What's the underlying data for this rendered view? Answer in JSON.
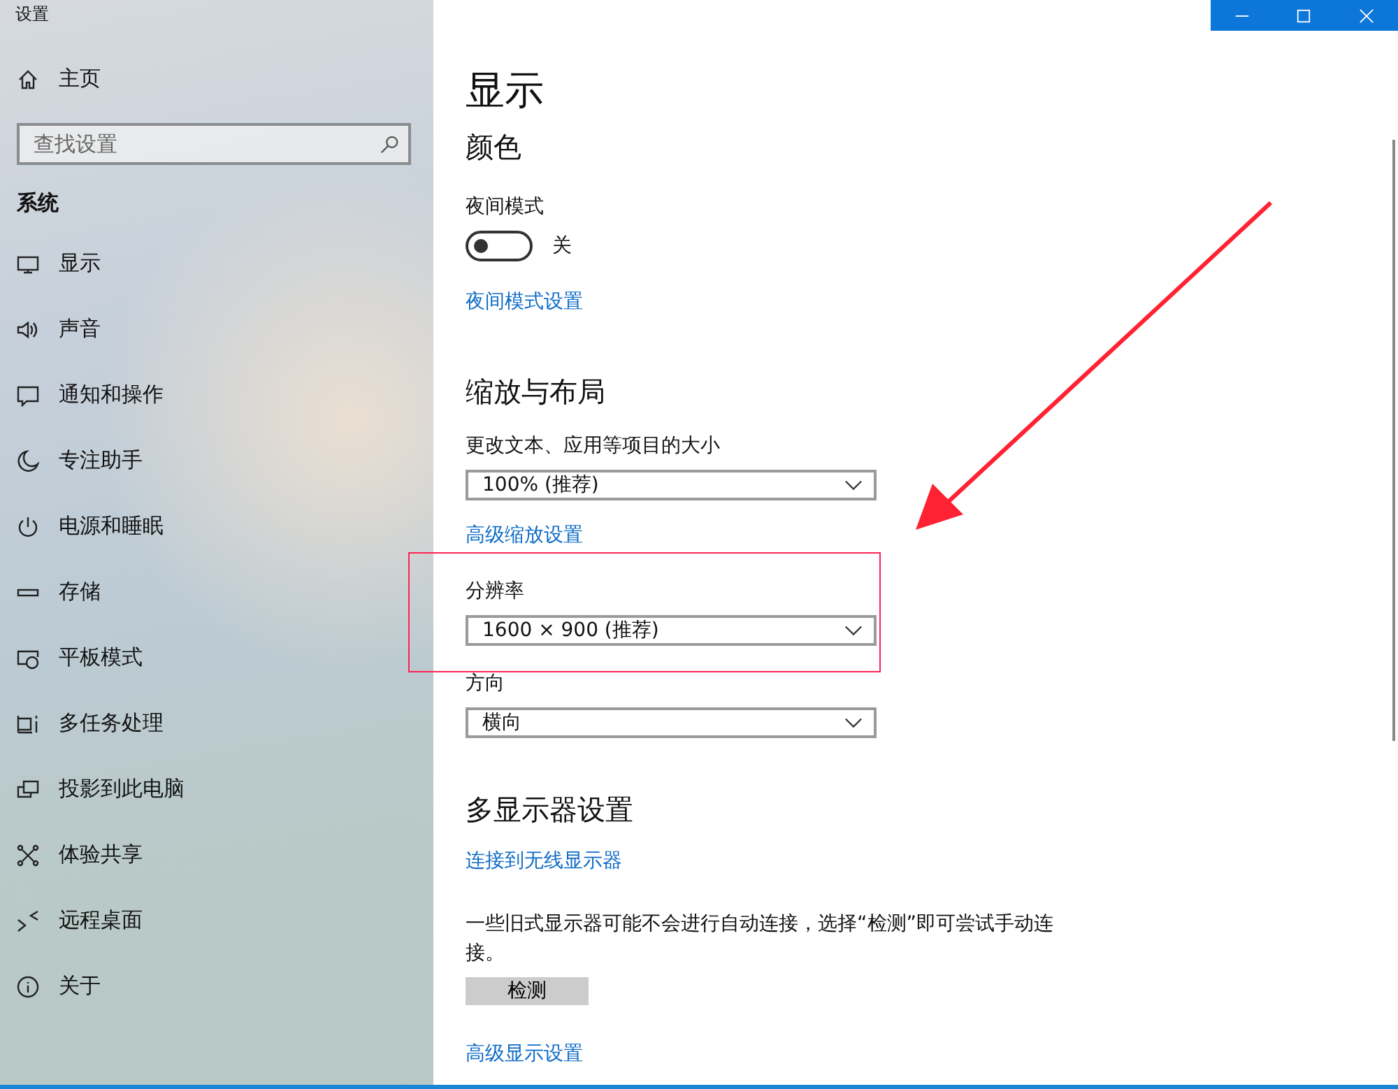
{
  "window": {
    "title": "设置"
  },
  "sidebar": {
    "home": "主页",
    "search": {
      "placeholder": "查找设置"
    },
    "section": "系统",
    "items": [
      {
        "label": "显示"
      },
      {
        "label": "声音"
      },
      {
        "label": "通知和操作"
      },
      {
        "label": "专注助手"
      },
      {
        "label": "电源和睡眠"
      },
      {
        "label": "存储"
      },
      {
        "label": "平板模式"
      },
      {
        "label": "多任务处理"
      },
      {
        "label": "投影到此电脑"
      },
      {
        "label": "体验共享"
      },
      {
        "label": "远程桌面"
      },
      {
        "label": "关于"
      }
    ]
  },
  "page": {
    "title": "显示",
    "items": [
      {
        "kind": "heading",
        "text": "颜色"
      },
      {
        "kind": "label",
        "text": "夜间模式"
      },
      {
        "kind": "toggle",
        "on": false,
        "text": "关"
      },
      {
        "kind": "link",
        "text": "夜间模式设置"
      },
      {
        "kind": "heading",
        "text": "缩放与布局"
      },
      {
        "kind": "label",
        "text": "更改文本、应用等项目的大小"
      },
      {
        "kind": "dropdown",
        "text": "100% (推荐)"
      },
      {
        "kind": "link",
        "text": "高级缩放设置"
      },
      {
        "kind": "label",
        "text": "分辨率"
      },
      {
        "kind": "dropdown",
        "text": "1600 × 900 (推荐)"
      },
      {
        "kind": "label",
        "text": "方向"
      },
      {
        "kind": "dropdown",
        "text": "横向"
      },
      {
        "kind": "heading",
        "text": "多显示器设置"
      },
      {
        "kind": "link",
        "text": "连接到无线显示器"
      },
      {
        "kind": "text",
        "text": "一些旧式显示器可能不会进行自动连接，选择“检测”即可尝试手动连接。"
      },
      {
        "kind": "button",
        "text": "检测"
      },
      {
        "kind": "link",
        "text": "高级显示设置"
      }
    ]
  }
}
